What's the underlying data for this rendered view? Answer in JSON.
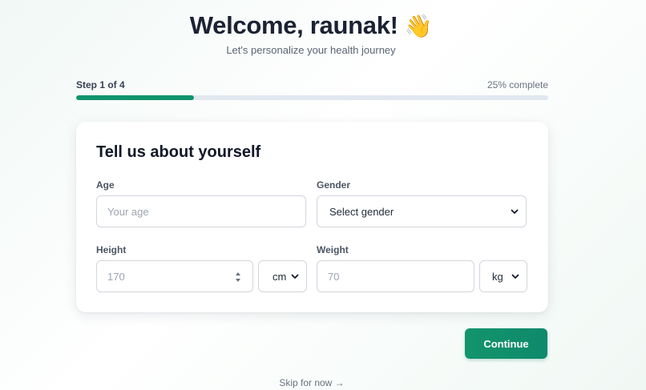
{
  "header": {
    "title": "Welcome, raunak!",
    "wave_emoji": "👋",
    "subtitle": "Let's personalize your health journey"
  },
  "progress": {
    "step_label": "Step 1 of 4",
    "percent_label": "25% complete",
    "fraction": 0.25
  },
  "form": {
    "title": "Tell us about yourself",
    "age": {
      "label": "Age",
      "placeholder": "Your age"
    },
    "gender": {
      "label": "Gender",
      "selected": "Select gender"
    },
    "height": {
      "label": "Height",
      "placeholder": "170",
      "unit": "cm"
    },
    "weight": {
      "label": "Weight",
      "placeholder": "70",
      "unit": "kg"
    }
  },
  "actions": {
    "continue_label": "Continue",
    "skip_label": "Skip for now →"
  },
  "colors": {
    "accent": "#12946d",
    "track": "#e2e8f0",
    "title": "#1a2233"
  }
}
